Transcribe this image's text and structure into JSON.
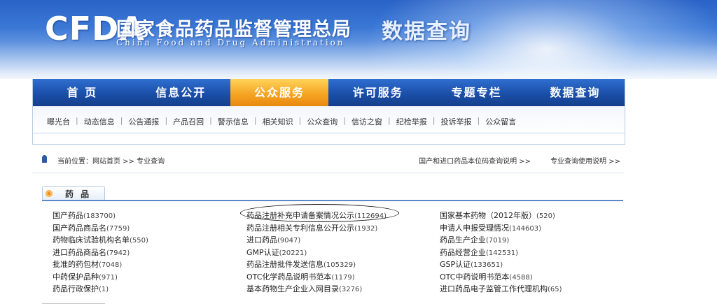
{
  "header": {
    "logo": "CFDA",
    "org_cn": "国家食品药品监督管理总局",
    "org_en": "China Food and Drug Administration",
    "site_title": "数据查询"
  },
  "nav": {
    "items": [
      {
        "label": "首  页",
        "active": false
      },
      {
        "label": "信息公开",
        "active": false
      },
      {
        "label": "公众服务",
        "active": true
      },
      {
        "label": "许可服务",
        "active": false
      },
      {
        "label": "专题专栏",
        "active": false
      },
      {
        "label": "数据查询",
        "active": false
      }
    ],
    "sub_items": [
      "曝光台",
      "动态信息",
      "公告通报",
      "产品召回",
      "警示信息",
      "相关知识",
      "公众查询",
      "信访之窗",
      "纪检举报",
      "投诉举报",
      "公众留言"
    ]
  },
  "breadcrumb": {
    "text": "当前位置：网站首页 >> 专业查询",
    "right_links": [
      "国产和进口药品本位码查询说明 >>",
      "专业查询使用说明 >>"
    ]
  },
  "section": {
    "title": "药 品"
  },
  "links": {
    "col1": [
      {
        "name": "国产药品",
        "count": "(183700)"
      },
      {
        "name": "国产药品商品名",
        "count": "(7759)"
      },
      {
        "name": "药物临床试验机构名单",
        "count": "(550)"
      },
      {
        "name": "进口药品商品名",
        "count": "(7942)"
      },
      {
        "name": "批准的药包材",
        "count": "(7048)"
      },
      {
        "name": "中药保护品种",
        "count": "(971)"
      },
      {
        "name": "药品行政保护",
        "count": "(1)"
      }
    ],
    "col2": [
      {
        "name": "药品注册补充申请备案情况公示",
        "count": "(112694)"
      },
      {
        "name": "药品注册相关专利信息公开公示",
        "count": "(1932)"
      },
      {
        "name": "进口药品",
        "count": "(9047)"
      },
      {
        "name": "GMP认证",
        "count": "(20221)"
      },
      {
        "name": "药品注册批件发送信息",
        "count": "(105329)"
      },
      {
        "name": "OTC化学药品说明书范本",
        "count": "(1179)"
      },
      {
        "name": "基本药物生产企业入网目录",
        "count": "(3276)"
      }
    ],
    "col3": [
      {
        "name": "国家基本药物（2012年版）",
        "count": "(520)"
      },
      {
        "name": "申请人申报受理情况",
        "count": "(144603)"
      },
      {
        "name": "药品生产企业",
        "count": "(7019)"
      },
      {
        "name": "药品经营企业",
        "count": "(142531)"
      },
      {
        "name": "GSP认证",
        "count": "(133651)"
      },
      {
        "name": "OTC中药说明书范本",
        "count": "(4588)"
      },
      {
        "name": "进口药品电子监管工作代理机构",
        "count": "(65)"
      }
    ]
  },
  "colors": {
    "nav_blue": "#1b4fa8",
    "nav_active": "#f6a623",
    "section_line": "#5b86c7"
  }
}
